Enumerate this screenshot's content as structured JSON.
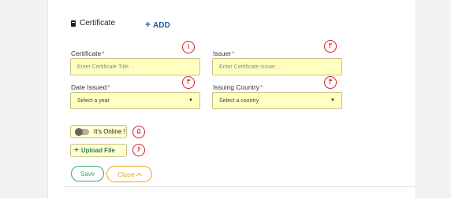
{
  "section": {
    "title": "Certificate",
    "add_label": "ADD"
  },
  "fields": {
    "certificate": {
      "label": "Certificate",
      "required_mark": "*",
      "placeholder": "Enter Certificate Title ..."
    },
    "issuer": {
      "label": "Issuer",
      "required_mark": "*",
      "placeholder": "Enter Certificate Issuer ..."
    },
    "date_issued": {
      "label": "Date Issued",
      "required_mark": "*",
      "value": "Select a year"
    },
    "issuing_country": {
      "label": "Issuing Country",
      "required_mark": "*",
      "value": "Select a country"
    }
  },
  "online_toggle": {
    "label": "It's Online !",
    "state": "off"
  },
  "upload": {
    "label": "Upload File"
  },
  "actions": {
    "save": "Save",
    "close": "Close"
  },
  "annotations": [
    "١",
    "٢",
    "٣",
    "۴",
    "۵",
    "۶"
  ],
  "colors": {
    "field_bg": "#ffffc0",
    "save": "#2eaa6b",
    "close": "#e8a51a",
    "add_link": "#1e5aa8",
    "annotation": "#d32020"
  }
}
